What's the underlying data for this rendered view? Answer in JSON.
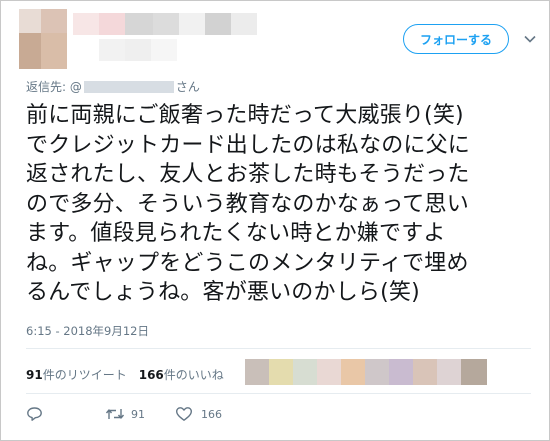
{
  "header": {
    "follow_label": "フォローする"
  },
  "reply": {
    "prefix": "返信先: @",
    "suffix": "さん"
  },
  "tweet": {
    "lines": [
      "前に両親にご飯奢った時だって大威張り(笑)",
      "でクレジットカード出したのは私なのに父に",
      "返されたし、友人とお茶した時もそうだった",
      "ので多分、そういう教育なのかなぁって思い",
      "ます。値段見られたくない時とか嫌ですよ",
      "ね。ギャップをどうこのメンタリティで埋め",
      "るんでしょうね。客が悪いのかしら(笑)"
    ],
    "timestamp": "6:15 - 2018年9月12日"
  },
  "stats": {
    "retweets_count": "91",
    "retweets_label": "件のリツイート",
    "likes_count": "166",
    "likes_label": "件のいいね"
  },
  "liker_avatar_colors": [
    "#c9bfb9",
    "#e4dcae",
    "#d7ddd2",
    "#e9d8d4",
    "#e9c7a7",
    "#cfc7c9",
    "#c9bbd0",
    "#d9c4b8",
    "#ded3d4",
    "#b5a89c"
  ],
  "actions": {
    "reply_icon": "speech-bubble-icon",
    "retweet_icon": "retweet-icon",
    "retweet_count": "91",
    "like_icon": "heart-icon",
    "like_count": "166"
  },
  "colors": {
    "accent": "#1da1f2",
    "muted_text": "#657786",
    "divider": "#e6ecf0"
  }
}
